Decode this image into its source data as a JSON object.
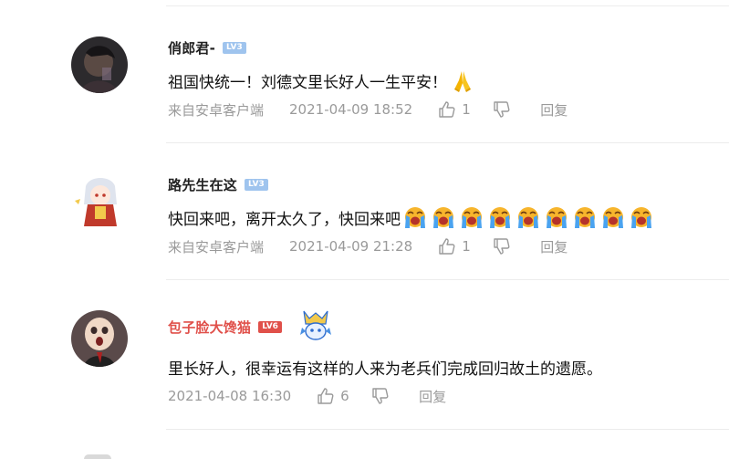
{
  "comments": [
    {
      "username": "俏郎君-",
      "level": "LV3",
      "text": "祖国快统一！刘德文里长好人一生平安！",
      "source": "来自安卓客户端",
      "time": "2021-04-09 18:52",
      "likes": "1",
      "reply": "回复",
      "emoji": "folded-hands"
    },
    {
      "username": "路先生在这",
      "level": "LV3",
      "text": "快回来吧，离开太久了，快回来吧",
      "source": "来自安卓客户端",
      "time": "2021-04-09 21:28",
      "likes": "1",
      "reply": "回复",
      "emoji": "crying-face",
      "emoji_count": 9
    },
    {
      "username": "包子脸大馋猫",
      "level": "LV6",
      "text": "里长好人，很幸运有这样的人来为老兵们完成回归故土的遗愿。",
      "source": "",
      "time": "2021-04-08 16:30",
      "likes": "6",
      "reply": "回复"
    }
  ],
  "colors": {
    "username": "#222222",
    "username_vip": "#e0504a",
    "meta": "#9a9a9a",
    "level_blue": "#9fc4ee",
    "level_red": "#e0504a"
  }
}
